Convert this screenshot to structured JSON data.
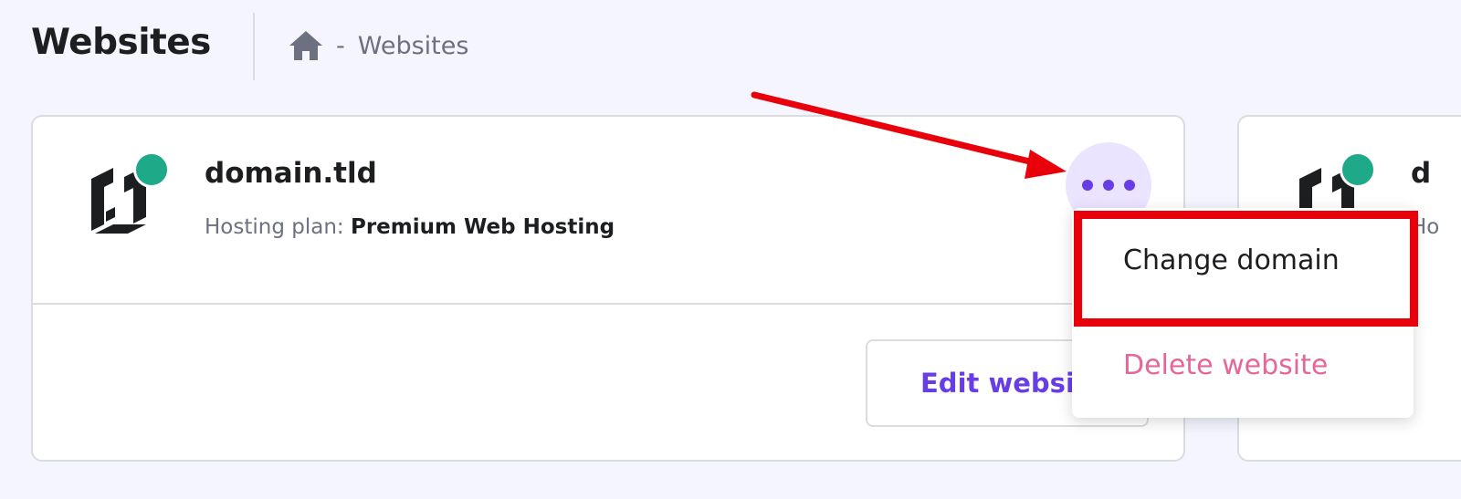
{
  "header": {
    "title": "Websites",
    "breadcrumb_separator": "-",
    "breadcrumb_current": "Websites"
  },
  "website_card": {
    "domain": "domain.tld",
    "plan_label": "Hosting plan:",
    "plan_value": "Premium Web Hosting",
    "status": "active",
    "edit_button_label": "Edit website",
    "more_button_icon": "more-horizontal-icon"
  },
  "dropdown": {
    "items": [
      {
        "label": "Change domain"
      },
      {
        "label": "Delete website"
      }
    ]
  },
  "next_card": {
    "domain_partial": "d",
    "plan_partial": "Ho"
  },
  "annotations": {
    "color": "#e8000b",
    "arrow_target": "more-options-button",
    "highlighted_item": "Change domain"
  },
  "colors": {
    "brand_purple": "#673de6",
    "status_green": "#1ea989",
    "danger_pink": "#e5679a",
    "background": "#f4f5fe"
  }
}
